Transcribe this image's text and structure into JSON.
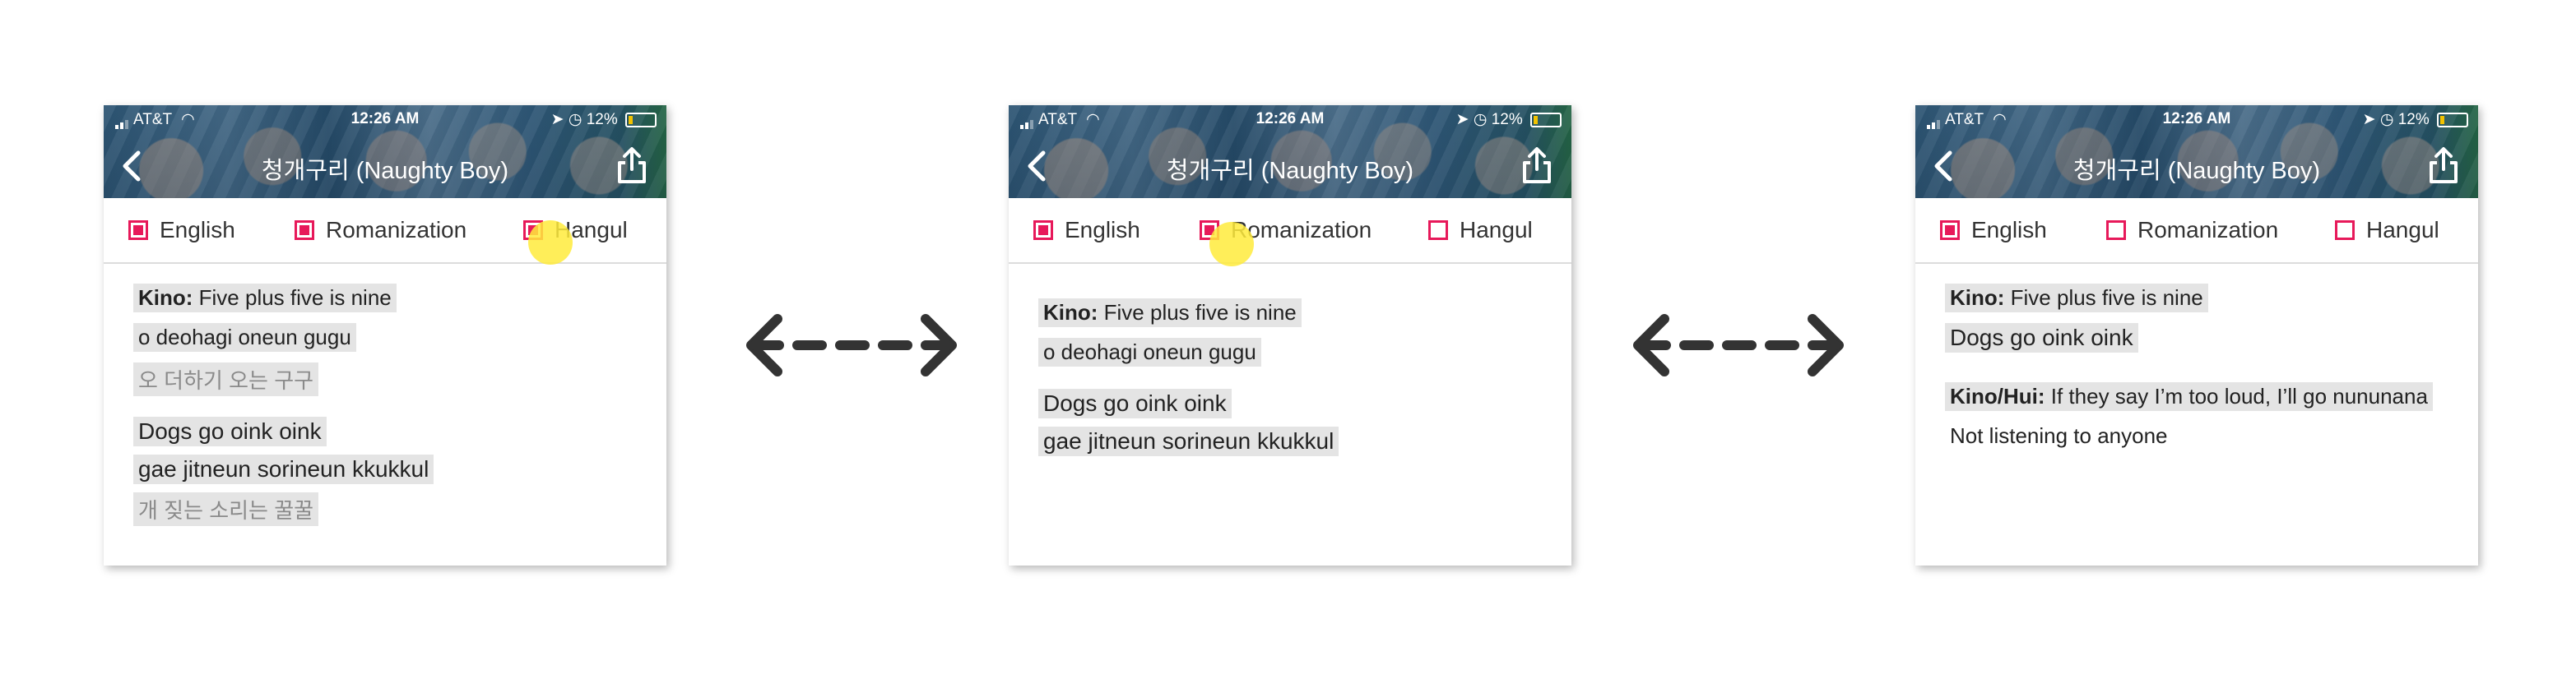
{
  "status": {
    "carrier": "AT&T",
    "time": "12:26 AM",
    "battery": "12%"
  },
  "song_title": "청개구리 (Naughty Boy)",
  "toggles": {
    "english": "English",
    "romanization": "Romanization",
    "hangul": "Hangul"
  },
  "screens": [
    {
      "english_on": true,
      "romanization_on": true,
      "hangul_on": true,
      "lines": [
        {
          "speaker": "Kino:",
          "text": " Five plus five is nine"
        },
        {
          "text": "o deohagi oneun gugu"
        },
        {
          "text": "오 더하기 오는 구구"
        },
        {
          "text": "Dogs go oink oink"
        },
        {
          "text": "gae jitneun sorineun kkukkul"
        },
        {
          "text": "개 짖는 소리는 꿀꿀"
        }
      ]
    },
    {
      "english_on": true,
      "romanization_on": true,
      "hangul_on": false,
      "lines": [
        {
          "speaker": "Kino:",
          "text": " Five plus five is nine"
        },
        {
          "text": "o deohagi oneun gugu"
        },
        {
          "text": "Dogs go oink oink"
        },
        {
          "text": "gae jitneun sorineun kkukkul"
        }
      ]
    },
    {
      "english_on": true,
      "romanization_on": false,
      "hangul_on": false,
      "lines": [
        {
          "speaker": "Kino:",
          "text": " Five plus five is nine"
        },
        {
          "text": "Dogs go oink oink"
        },
        {
          "speaker": "Kino/Hui:",
          "text": " If they say I’m too loud, I’ll go nununana"
        },
        {
          "text": "Not listening to anyone"
        }
      ]
    }
  ]
}
